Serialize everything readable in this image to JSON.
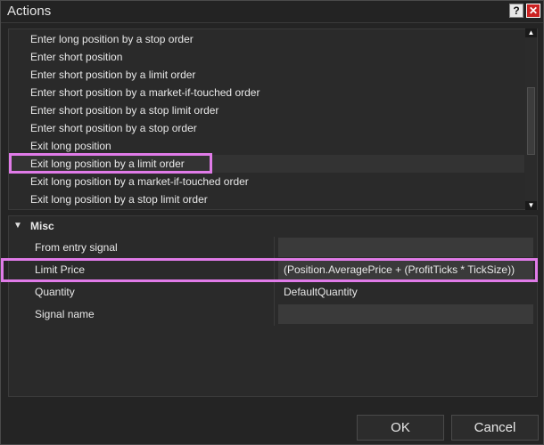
{
  "window": {
    "title": "Actions",
    "help_glyph": "?",
    "close_glyph": "✕"
  },
  "actions_list": {
    "items": [
      {
        "label": "Enter long position by a stop order"
      },
      {
        "label": "Enter short position"
      },
      {
        "label": "Enter short position by a limit order"
      },
      {
        "label": "Enter short position by a market-if-touched order"
      },
      {
        "label": "Enter short position by a stop limit order"
      },
      {
        "label": "Enter short position by a stop order"
      },
      {
        "label": "Exit long position"
      },
      {
        "label": "Exit long position by a limit order"
      },
      {
        "label": "Exit long position by a market-if-touched order"
      },
      {
        "label": "Exit long position by a stop limit order"
      }
    ],
    "selected_label": "Exit long position by a limit order",
    "scroll_up_glyph": "▲",
    "scroll_down_glyph": "▼"
  },
  "properties": {
    "category": {
      "label": "Misc",
      "toggle_glyph": "▼"
    },
    "rows": [
      {
        "name": "From entry signal",
        "value": ""
      },
      {
        "name": "Limit Price",
        "value": "(Position.AveragePrice + (ProfitTicks * TickSize))"
      },
      {
        "name": "Quantity",
        "value": "DefaultQuantity"
      },
      {
        "name": "Signal name",
        "value": ""
      }
    ]
  },
  "buttons": {
    "ok_label": "OK",
    "cancel_label": "Cancel"
  },
  "colors": {
    "highlight": "#e07be8",
    "background": "#242424",
    "close_button": "#cc2222"
  }
}
